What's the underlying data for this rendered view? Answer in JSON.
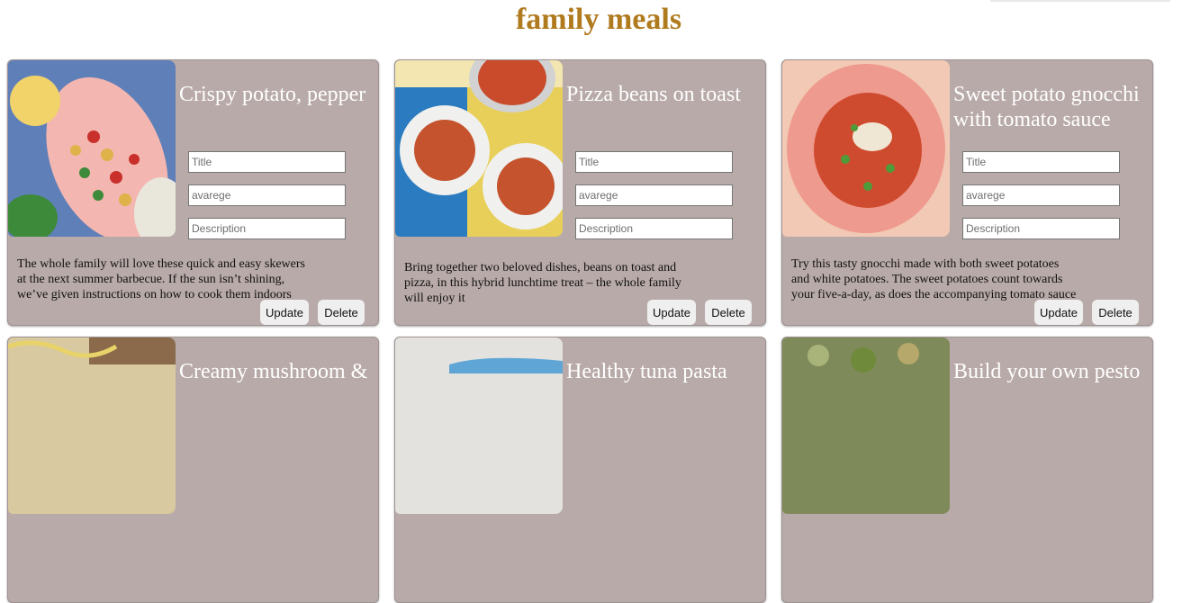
{
  "page": {
    "title": "family meals"
  },
  "placeholders": {
    "title": "Title",
    "average": "avarege",
    "description": "Description"
  },
  "buttons": {
    "update": "Update",
    "delete": "Delete"
  },
  "cards": [
    {
      "title": "Crispy potato, pepper",
      "description": "The whole family will love these quick and easy skewers at the next summer barbecue. If the sun isn’t shining, we’ve given instructions on how to cook them indoors"
    },
    {
      "title": "Pizza beans on toast",
      "description": "Bring together two beloved dishes, beans on toast and pizza, in this hybrid lunchtime treat – the whole family will enjoy it"
    },
    {
      "title": "Sweet potato gnocchi with tomato sauce",
      "description": "Try this tasty gnocchi made with both sweet potatoes and white potatoes. The sweet potatoes count towards your five-a-day, as does the accompanying tomato sauce"
    },
    {
      "title": "Creamy mushroom &",
      "description": ""
    },
    {
      "title": "Healthy tuna pasta",
      "description": ""
    },
    {
      "title": "Build your own pesto",
      "description": ""
    }
  ]
}
